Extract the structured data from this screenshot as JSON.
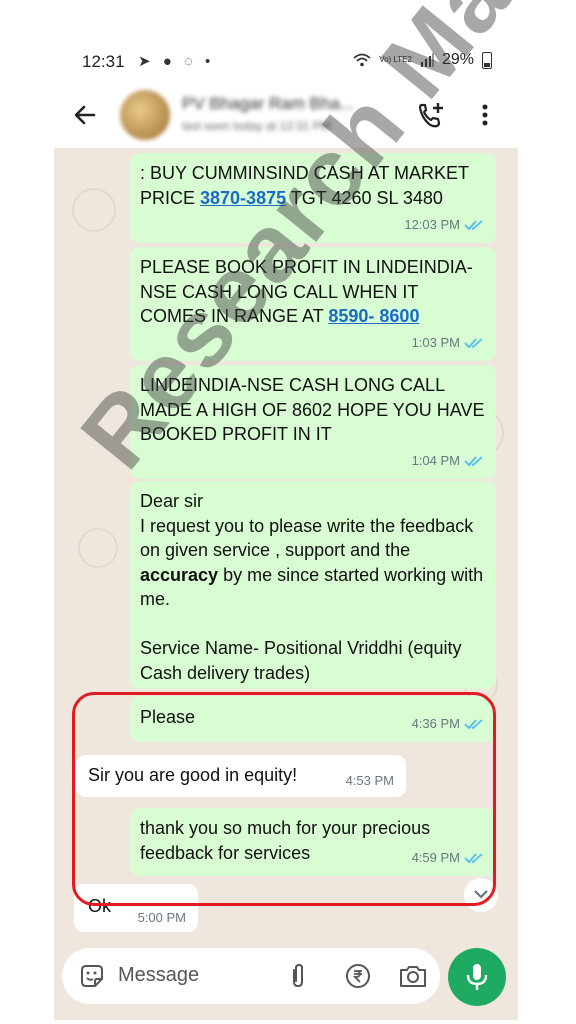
{
  "status_bar": {
    "time": "12:31",
    "notification_icons": "➤ ● ◌ •",
    "network": "Vo) LTE2",
    "battery_percent": "29%"
  },
  "header": {
    "contact_name": "PV Bhagar Ram Bha...",
    "contact_status": "last seen today at 12:31 PM"
  },
  "messages": [
    {
      "type": "out",
      "pre": ": BUY CUMMINSIND CASH AT MARKET PRICE ",
      "link": "3870-3875",
      "post": " TGT 4260 SL 3480",
      "time": "12:03 PM"
    },
    {
      "type": "out",
      "pre": "PLEASE BOOK PROFIT IN LINDEINDIA-NSE CASH LONG CALL WHEN IT COMES IN RANGE AT ",
      "link": "8590- 8600",
      "post": "",
      "time": "1:03 PM"
    },
    {
      "type": "out",
      "text": "LINDEINDIA-NSE CASH LONG CALL MADE A HIGH OF 8602 HOPE YOU HAVE BOOKED PROFIT IN IT",
      "time": "1:04 PM"
    },
    {
      "type": "out",
      "pre": "Dear sir\nI request you to please write the feedback on given service , support and the ",
      "bold": "accuracy",
      "post": " by me since started working with me.\n\nService Name- Positional Vriddhi (equity Cash delivery trades)"
    },
    {
      "type": "out",
      "text": "Please",
      "time": "4:36 PM"
    },
    {
      "type": "in",
      "text": "Sir you are good in equity!",
      "time": "4:53 PM"
    },
    {
      "type": "out",
      "text": "thank you so much for your precious feedback for services",
      "time": "4:59 PM"
    },
    {
      "type": "in",
      "text": "Ok",
      "time": "5:00 PM"
    }
  ],
  "input": {
    "placeholder": "Message"
  },
  "watermark": "Research Mart",
  "colors": {
    "outgoing_bubble": "#d9fdd3",
    "incoming_bubble": "#ffffff",
    "chat_background": "#efe7dd",
    "link": "#1a6bc7",
    "read_ticks": "#53bdeb",
    "mic_button": "#1eaa61",
    "highlight_border": "#e11b22"
  },
  "icons": [
    "back-arrow-icon",
    "add-call-icon",
    "more-vert-icon",
    "sticker-icon",
    "attach-icon",
    "rupee-icon",
    "camera-icon",
    "mic-icon",
    "double-check-icon"
  ]
}
